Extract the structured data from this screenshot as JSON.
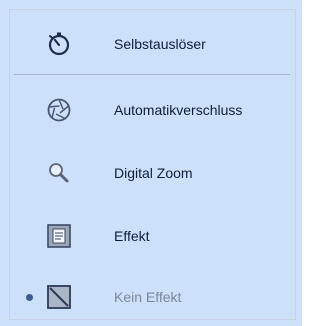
{
  "menu": {
    "items": [
      {
        "label": "Selbstauslöser",
        "icon": "self-timer-icon",
        "enabled": true
      },
      {
        "label": "Automatikverschluss",
        "icon": "aperture-icon",
        "enabled": true
      },
      {
        "label": "Digital Zoom",
        "icon": "magnifier-icon",
        "enabled": true
      },
      {
        "label": "Effekt",
        "icon": "effect-icon",
        "enabled": true
      },
      {
        "label": "Kein Effekt",
        "icon": "no-effect-icon",
        "enabled": false,
        "selected": true
      }
    ]
  },
  "colors": {
    "menu_background": "#cde2fa",
    "text": "#0d1d3a",
    "disabled_text": "#7c8698",
    "bullet": "#3a5d93"
  }
}
